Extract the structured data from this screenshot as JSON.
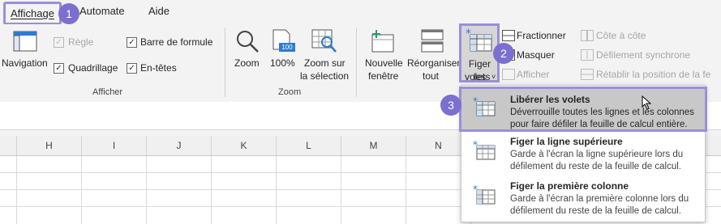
{
  "tabs": {
    "affichage": "Affichage",
    "automate": "Automate",
    "aide": "Aide"
  },
  "steps": {
    "one": "1",
    "two": "2",
    "three": "3"
  },
  "afficher_group": {
    "label": "Afficher",
    "navigation": "Navigation",
    "regle": "Règle",
    "quadrillage": "Quadrillage",
    "barre_formule": "Barre de formule",
    "entetes": "En-têtes"
  },
  "zoom_group": {
    "label": "Zoom",
    "zoom": "Zoom",
    "pct_icon": "100",
    "pct": "100%",
    "zoom_sel_line1": "Zoom sur",
    "zoom_sel_line2": "la sélection"
  },
  "window_group": {
    "new_window_line1": "Nouvelle",
    "new_window_line2": "fenêtre",
    "arrange_line1": "Réorganiser",
    "arrange_line2": "tout",
    "freeze_line1": "Figer les",
    "freeze_line2": "volets",
    "freeze_caret": "˅",
    "split": "Fractionner",
    "hide": "Masquer",
    "show": "Afficher",
    "side_by_side": "Côte à côte",
    "sync_scroll": "Défilement synchrone",
    "reset_pos": "Rétablir la position de la fe"
  },
  "columns": [
    "H",
    "I",
    "J",
    "K",
    "L",
    "M",
    "N"
  ],
  "dropdown": {
    "items": [
      {
        "title": "Libérer les volets",
        "desc": "Déverrouille toutes les lignes et les colonnes pour faire défiler la feuille de calcul entière."
      },
      {
        "title": "Figer la ligne supérieure",
        "desc": "Garde à l'écran la ligne supérieure lors du défilement du reste de la feuille de calcul."
      },
      {
        "title": "Figer la première colonne",
        "desc": "Garde à l'écran la première colonne lors du défilement du reste de la feuille de calcul."
      }
    ]
  },
  "colors": {
    "accent": "#7b6fcf",
    "highlight": "#9b8ed9",
    "freeze_icon": "#2b7cd3"
  }
}
